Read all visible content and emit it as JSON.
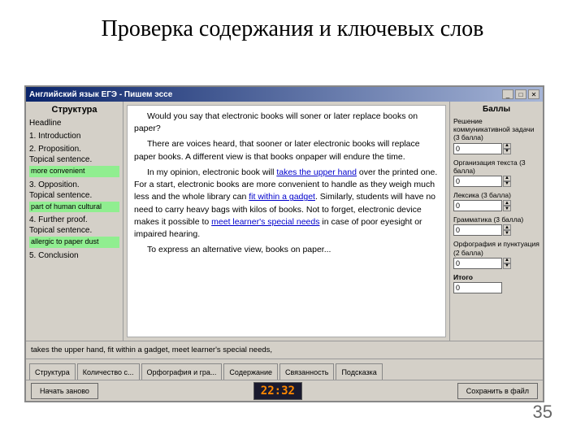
{
  "title": "Проверка содержания и ключевых слов",
  "slide_number": "35",
  "window": {
    "title_bar": "Английский язык  ЕГЭ - Пишем эссе",
    "tb_minimize": "_",
    "tb_maximize": "□",
    "tb_close": "✕"
  },
  "sidebar": {
    "header": "Структура",
    "items": [
      {
        "label": "Headline"
      },
      {
        "label": "1. Introduction"
      },
      {
        "label": "2. Proposition.\nTopical sentence.",
        "highlight": "more convenient"
      },
      {
        "label": "3. Opposition.\nTopical sentence.",
        "highlight": "part of human cultural"
      },
      {
        "label": "4. Further proof.\nTopical sentence.",
        "highlight": "allergic to paper dust"
      },
      {
        "label": "5. Conclusion"
      }
    ]
  },
  "text_content": {
    "para1": "Would you say that electronic books will soner or later replace books on paper?",
    "para2": "There are voices heard, that sooner or later electronic books will replace paper books. A different view is that books onpaper will endure the time.",
    "para3_start": "In my opinion, electronic book will ",
    "link1": "takes the upper hand",
    "para3_mid": " over the printed one. For a start, electronic books are more convenient to handle as they weigh much less and the whole library can ",
    "link2": "fit within a gadget",
    "para3_end": ". Similarly, students will have no need to carry heavy bags with kilos of books. Not to forget, electronic device makes it possible to ",
    "link3": "meet learner's special needs",
    "para3_final": " in case of poor eyesight or impaired hearing.",
    "para4_start": "To express an alternative view, books on paper..."
  },
  "scores": {
    "header": "Баллы",
    "items": [
      {
        "label": "Решение коммуникативной задачи (3 балла)",
        "value": "0"
      },
      {
        "label": "Организация текста (3 балла)",
        "value": "0"
      },
      {
        "label": "Лексика (3 балла)",
        "value": "0"
      },
      {
        "label": "Грамматика (3 балла)",
        "value": "0"
      },
      {
        "label": "Орфография и пунктуация (2 балла)",
        "value": "0"
      }
    ],
    "total_label": "Итого",
    "total_value": "0"
  },
  "keyword_bar": {
    "text": "takes the upper hand, fit within a gadget, meet learner's special needs,"
  },
  "tabs": [
    {
      "label": "Структура"
    },
    {
      "label": "Количество с..."
    },
    {
      "label": "Орфография и гра..."
    },
    {
      "label": "Содержание"
    },
    {
      "label": "Связанность"
    },
    {
      "label": "Подсказка"
    }
  ],
  "actions": {
    "restart_label": "Начать заново",
    "save_label": "Сохранить в файл",
    "timer": "22:32"
  }
}
